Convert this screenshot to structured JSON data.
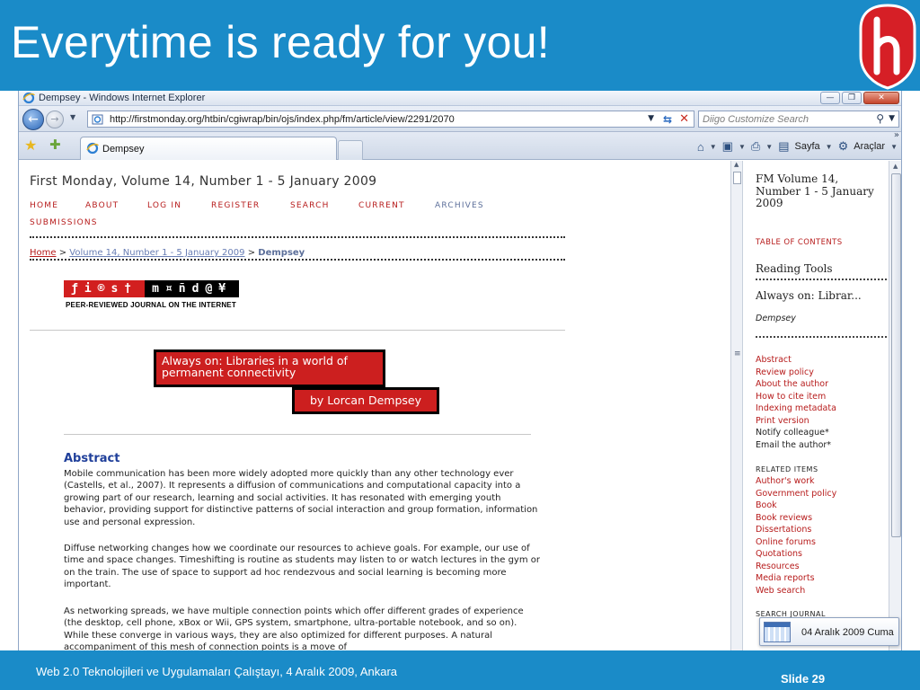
{
  "slide": {
    "title": "Everytime is ready for you!",
    "footer_text": "Web 2.0 Teknolojileri ve Uygulamaları Çalıştayı, 4 Aralık 2009, Ankara",
    "slide_number": "Slide 29",
    "header_color": "#1a8bc8"
  },
  "browser": {
    "window_title": "Dempsey - Windows Internet Explorer",
    "address_url": "http://firstmonday.org/htbin/cgiwrap/bin/ojs/index.php/fm/article/view/2291/2070",
    "search_placeholder": "Diigo Customize Search",
    "tab_label": "Dempsey",
    "page_menu": "Sayfa",
    "tools_menu": "Araçlar"
  },
  "page": {
    "journal_title": "First Monday, Volume 14, Number 1 - 5 January 2009",
    "menu": [
      "HOME",
      "ABOUT",
      "LOG IN",
      "REGISTER",
      "SEARCH",
      "CURRENT",
      "ARCHIVES",
      "SUBMISSIONS"
    ],
    "breadcrumb": {
      "home": "Home",
      "separator": ">",
      "issue": "Volume 14, Number 1 - 5 January 2009",
      "current": "Dempsey"
    },
    "logo_tagline": "PEER-REVIEWED JOURNAL ON THE INTERNET",
    "article_title": "Always on: Libraries in a world of permanent connectivity",
    "article_author": "by Lorcan Dempsey",
    "abstract_heading": "Abstract",
    "paragraphs": [
      "Mobile communication has been more widely adopted more quickly than any other technology ever (Castells, et al., 2007). It represents a diffusion of communications and computational capacity into a growing part of our research, learning and social activities. It has resonated with emerging youth behavior, providing support for distinctive patterns of social interaction and group formation, information use and personal expression.",
      "Diffuse networking changes how we coordinate our resources to achieve goals. For example, our use of time and space changes. Timeshifting is routine as students may listen to or watch lectures in the gym or on the train. The use of space to support ad hoc rendezvous and social learning is becoming more important.",
      "As networking spreads, we have multiple connection points which offer different grades of experience (the desktop, cell phone, xBox or Wii, GPS system, smartphone, ultra-portable notebook, and so on). While these converge in various ways, they are also optimized for different purposes. A natural accompaniment of this mesh of connection points is a move of"
    ]
  },
  "sidebar": {
    "fm_block": "FM Volume 14, Number 1 - 5 January 2009",
    "toc": "TABLE OF CONTENTS",
    "reading_tools": "Reading Tools",
    "article_short": "Always on: Librar...",
    "author": "Dempsey",
    "links": [
      "Abstract",
      "Review policy",
      "About the author",
      "How to cite item",
      "Indexing metadata",
      "Print version"
    ],
    "plain_items": [
      "Notify colleague*",
      "Email the author*"
    ],
    "related_heading": "RELATED ITEMS",
    "related_links": [
      "Author's work",
      "Government policy",
      "Book",
      "Book reviews",
      "Dissertations",
      "Online forums",
      "Quotations",
      "Resources",
      "Media reports",
      "Web search"
    ],
    "search_heading": "SEARCH JOURNAL"
  },
  "taskbar": {
    "date": "04 Aralık 2009 Cuma"
  }
}
